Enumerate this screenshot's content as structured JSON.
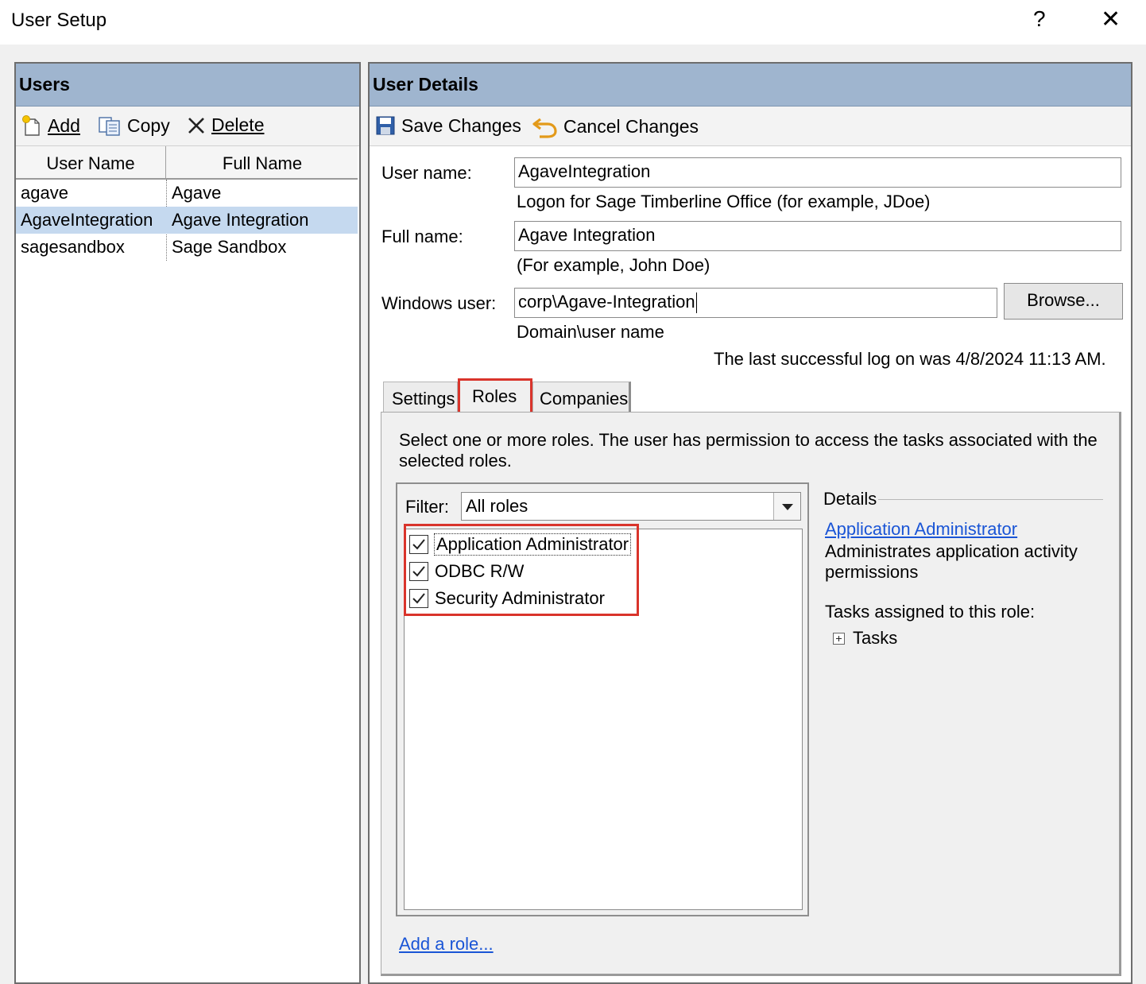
{
  "window": {
    "title": "User Setup",
    "help_glyph": "?",
    "close_glyph": "✕"
  },
  "users_panel": {
    "header": "Users",
    "toolbar": {
      "add": "Add",
      "copy": "Copy",
      "delete": "Delete"
    },
    "columns": [
      "User Name",
      "Full Name"
    ],
    "rows": [
      {
        "user": "agave",
        "full": "Agave"
      },
      {
        "user": "AgaveIntegration",
        "full": "Agave Integration"
      },
      {
        "user": "sagesandbox",
        "full": "Sage Sandbox"
      }
    ]
  },
  "details_panel": {
    "header": "User Details",
    "toolbar": {
      "save": "Save Changes",
      "cancel": "Cancel Changes"
    },
    "user_name": {
      "label": "User name:",
      "value": "AgaveIntegration",
      "hint": "Logon for Sage Timberline Office (for example, JDoe)"
    },
    "full_name": {
      "label": "Full name:",
      "value": "Agave Integration",
      "hint": "(For example, John Doe)"
    },
    "windows_user": {
      "label": "Windows user:",
      "value": "corp\\Agave-Integration",
      "hint": "Domain\\user name",
      "browse": "Browse..."
    },
    "last_logon": "The last successful log on was 4/8/2024 11:13 AM.",
    "tabs": [
      "Settings",
      "Roles",
      "Companies"
    ],
    "active_tab": "Roles",
    "roles_tab": {
      "instructions": "Select one or more roles. The user has permission to access the tasks associated with the selected roles.",
      "filter_label": "Filter:",
      "filter_value": "All roles",
      "roles": [
        {
          "label": "Application Administrator",
          "checked": true
        },
        {
          "label": "ODBC R/W",
          "checked": true
        },
        {
          "label": "Security Administrator",
          "checked": true
        }
      ],
      "add_role_link": "Add a role...",
      "details": {
        "title": "Details",
        "role_link": "Application Administrator",
        "description": "Administrates application activity permissions",
        "tasks_label": "Tasks assigned to this role:",
        "tasks_node": "Tasks"
      }
    }
  },
  "colors": {
    "header_bg": "#9fb5cf",
    "selected_row": "#c5d9ef",
    "highlight": "#d9342b",
    "link": "#1a55d6"
  }
}
